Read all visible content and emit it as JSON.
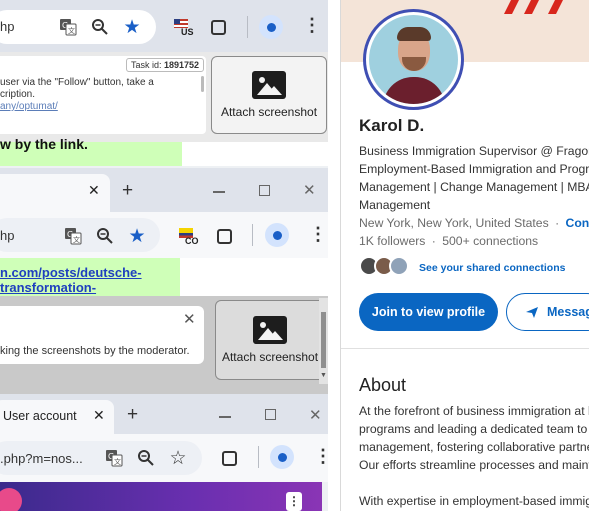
{
  "browser1": {
    "url_fragment": "hp",
    "country_badge": "US",
    "task_id_label": "Task id: ",
    "task_id": "1891752",
    "note_line1": "user via the \"Follow\" button, take a",
    "note_line2": "cription.",
    "note_link": "any/optumat/",
    "attach_label": "Attach screenshot",
    "banner_text": "w by the link."
  },
  "browser2": {
    "close_glyph": "✕",
    "new_tab_glyph": "+",
    "url_fragment": "hp",
    "country_badge": "CO",
    "link_line1": "n.com/posts/deutsche-",
    "link_line2": "transformation-",
    "moderator_note": "king the screenshots by the moderator.",
    "attach_label": "Attach screenshot"
  },
  "browser3": {
    "tab_title": "User account",
    "close_glyph": "✕",
    "new_tab_glyph": "+",
    "url_fragment": ".php?m=nos..."
  },
  "linkedin": {
    "name": "Karol D.",
    "headline_lines": [
      "Business Immigration Supervisor @ Fragom",
      "Employment-Based Immigration and Progra",
      "Management | Change Management | MBA",
      "Management"
    ],
    "location": "New York, New York, United States",
    "separator": "·",
    "contact": "Conta",
    "followers": "1K followers",
    "connections": "500+ connections",
    "shared": "See your shared connections",
    "join_button": "Join to view profile",
    "message_button": "Messag",
    "about_title": "About",
    "about_lines": [
      "At the forefront of business immigration at l",
      "programs and leading a dedicated team to o",
      "management, fostering collaborative partne",
      "Our efforts streamline processes and mainta"
    ],
    "about_line5": "With expertise in employment-based immig"
  },
  "colors": {
    "accent_blue": "#0a66c2",
    "star_blue": "#1a5fc7",
    "banner_green": "#cfffb8",
    "brand_red": "#d8261c"
  }
}
